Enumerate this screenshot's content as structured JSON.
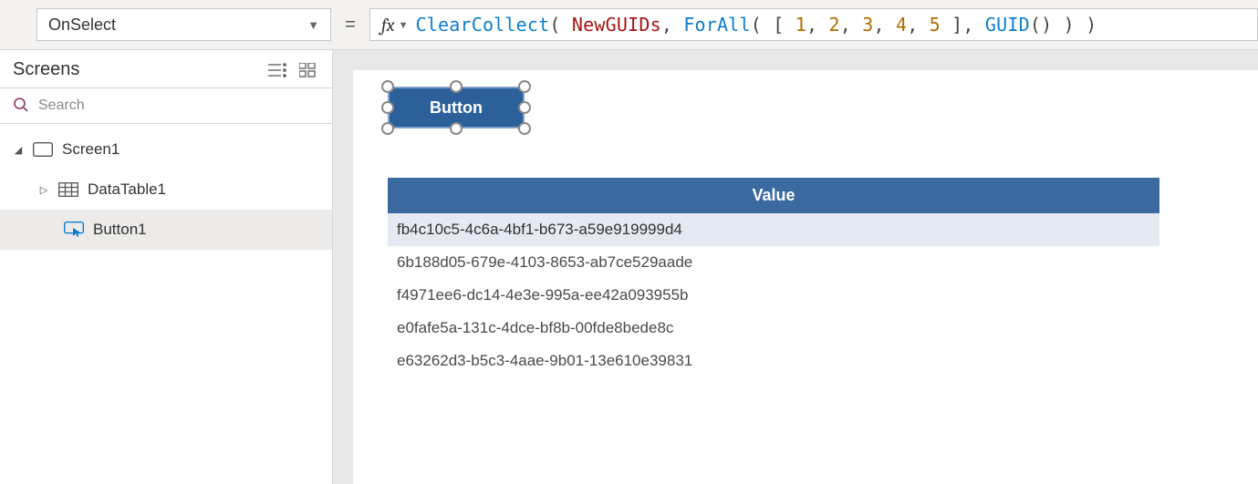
{
  "property_selector": {
    "value": "OnSelect"
  },
  "formula": {
    "tokens": [
      {
        "t": "ClearCollect",
        "c": "t-fn"
      },
      {
        "t": "( ",
        "c": "t-punc"
      },
      {
        "t": "NewGUIDs",
        "c": "t-id"
      },
      {
        "t": ", ",
        "c": "t-punc"
      },
      {
        "t": "ForAll",
        "c": "t-fn"
      },
      {
        "t": "( [ ",
        "c": "t-punc"
      },
      {
        "t": "1",
        "c": "t-num"
      },
      {
        "t": ", ",
        "c": "t-punc"
      },
      {
        "t": "2",
        "c": "t-num"
      },
      {
        "t": ", ",
        "c": "t-punc"
      },
      {
        "t": "3",
        "c": "t-num"
      },
      {
        "t": ", ",
        "c": "t-punc"
      },
      {
        "t": "4",
        "c": "t-num"
      },
      {
        "t": ", ",
        "c": "t-punc"
      },
      {
        "t": "5",
        "c": "t-num"
      },
      {
        "t": " ], ",
        "c": "t-punc"
      },
      {
        "t": "GUID",
        "c": "t-fn"
      },
      {
        "t": "() ) )",
        "c": "t-punc"
      }
    ]
  },
  "sidebar": {
    "title": "Screens",
    "search_placeholder": "Search",
    "tree": {
      "screen": "Screen1",
      "datatable": "DataTable1",
      "button": "Button1"
    }
  },
  "canvas": {
    "button_label": "Button",
    "datatable": {
      "header": "Value",
      "rows": [
        "fb4c10c5-4c6a-4bf1-b673-a59e919999d4",
        "6b188d05-679e-4103-8653-ab7ce529aade",
        "f4971ee6-dc14-4e3e-995a-ee42a093955b",
        "e0fafe5a-131c-4dce-bf8b-00fde8bede8c",
        "e63262d3-b5c3-4aae-9b01-13e610e39831"
      ]
    }
  }
}
